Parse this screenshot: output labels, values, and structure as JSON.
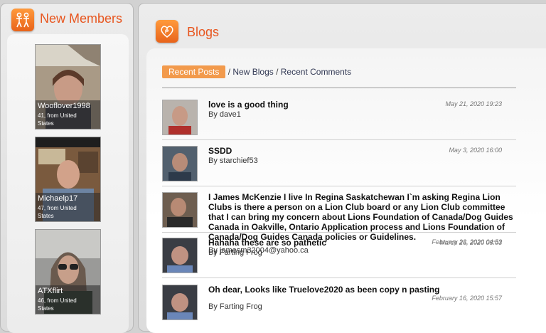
{
  "members_panel": {
    "title": "New Members",
    "members": [
      {
        "name": "Wooflover1998",
        "info_line1": "41, from United",
        "info_line2": "States"
      },
      {
        "name": "Michaelp17",
        "info_line1": "47, from United",
        "info_line2": "States"
      },
      {
        "name": "ATXflirt",
        "info_line1": "46, from United",
        "info_line2": "States"
      }
    ]
  },
  "blogs_panel": {
    "title": "Blogs",
    "tabs": {
      "active": "Recent Posts",
      "sep1": " / ",
      "new_blogs": "New Blogs",
      "sep2": " / ",
      "recent_comments": "Recent Comments"
    },
    "posts": [
      {
        "title": "love is a good thing",
        "author": "By dave1",
        "date": "May 21, 2020 19:23"
      },
      {
        "title": "SSDD",
        "author": "By starchief53",
        "date": "May 3, 2020 16:00"
      },
      {
        "title": "I James McKenzie I live In Regina Saskatchewan I`m asking Regina Lion Clubs is there a person on a Lion Club board or any Lion Club committee that I can bring my concern about Lions Foundation of Canada/Dog Guides Canada in Oakville, Ontario Application process and Lions Foundation of Canada/Dog Guides Canada policies or Guidelines.",
        "author": "By jamesm32004@yahoo.ca",
        "date": "March 26, 2020 08:03"
      },
      {
        "title": "Hahaha these are so pathetic",
        "author": "By Farting Frog",
        "date": "February 23, 2020 04:53"
      },
      {
        "title": "Oh dear, Looks like Truelove2020 as been copy n pasting",
        "author": "By Farting Frog",
        "date": "February 16, 2020 15:57"
      }
    ]
  },
  "colors": {
    "accent": "#e8561f",
    "tab_active_bg": "#f29a4c"
  }
}
